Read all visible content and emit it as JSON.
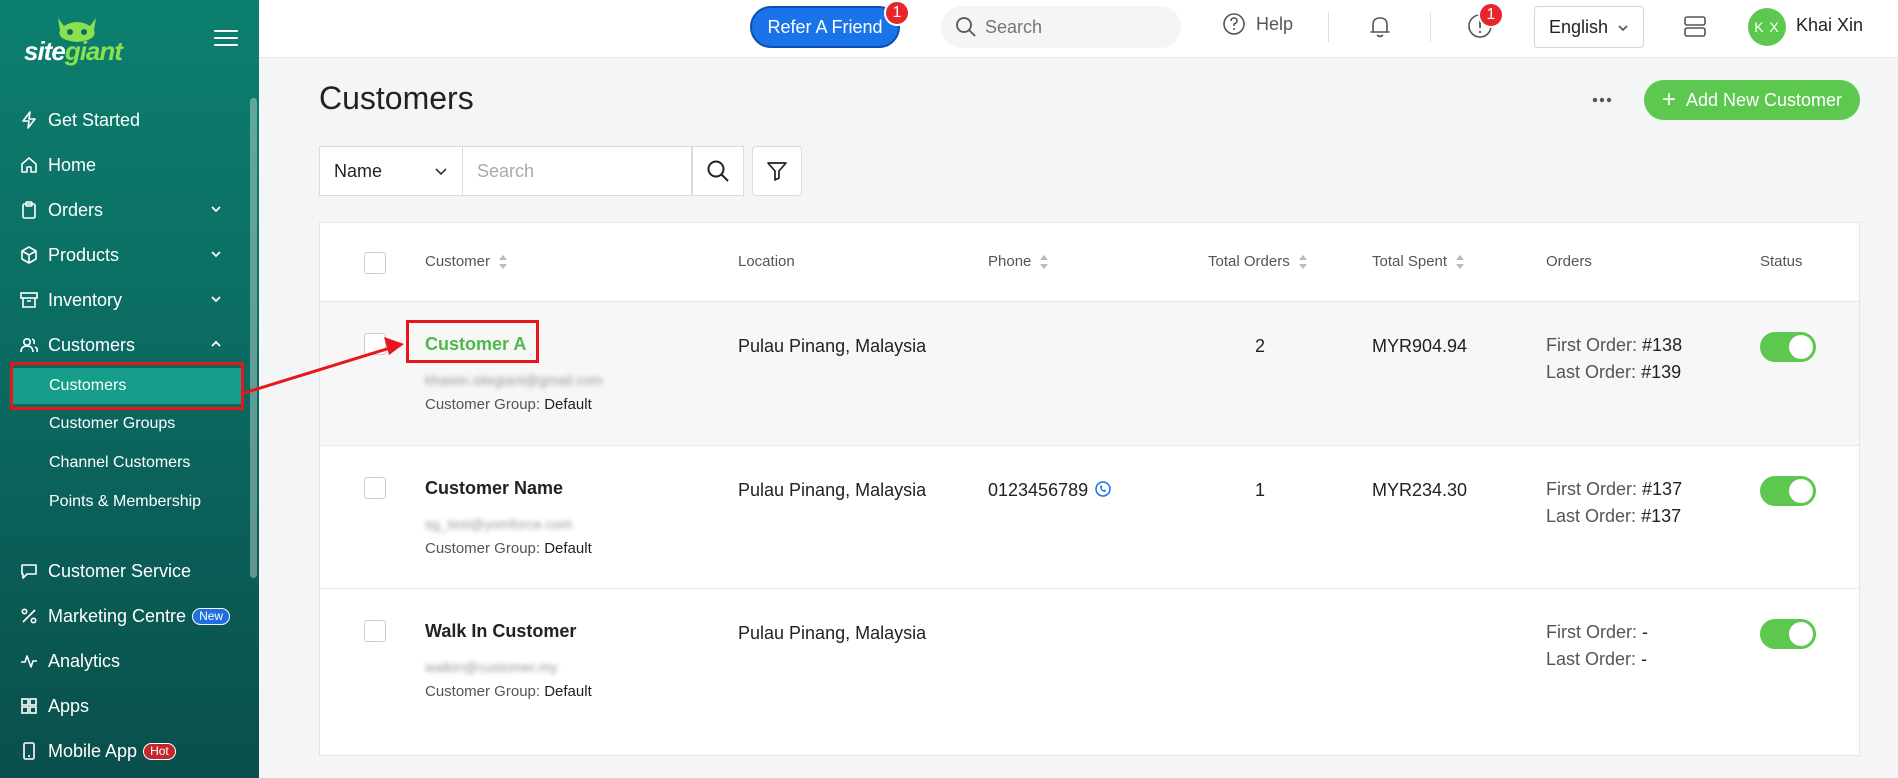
{
  "sidebar": {
    "brand": {
      "part1": "site",
      "part2": "giant"
    },
    "items": [
      {
        "label": "Get Started",
        "icon": "bolt-icon"
      },
      {
        "label": "Home",
        "icon": "home-icon"
      },
      {
        "label": "Orders",
        "icon": "clipboard-icon"
      },
      {
        "label": "Products",
        "icon": "box-icon"
      },
      {
        "label": "Inventory",
        "icon": "archive-icon"
      },
      {
        "label": "Customers",
        "icon": "users-icon"
      },
      {
        "label": "Customer Service",
        "icon": "chat-icon"
      },
      {
        "label": "Marketing Centre",
        "icon": "percent-icon",
        "badge": "New"
      },
      {
        "label": "Analytics",
        "icon": "pulse-icon"
      },
      {
        "label": "Apps",
        "icon": "grid-icon"
      },
      {
        "label": "Mobile App",
        "icon": "phone-icon",
        "badge": "Hot"
      }
    ],
    "customers_sub": [
      "Customers",
      "Customer Groups",
      "Channel Customers",
      "Points & Membership"
    ]
  },
  "topbar": {
    "refer_label": "Refer A Friend",
    "refer_badge": "1",
    "search_placeholder": "Search",
    "help_label": "Help",
    "alert_badge": "1",
    "language": "English",
    "avatar_initials": "K X",
    "user_name": "Khai Xin"
  },
  "main": {
    "title": "Customers",
    "add_button": "Add New Customer",
    "filter_field": "Name",
    "search_placeholder": "Search"
  },
  "table": {
    "columns": [
      "Customer",
      "Location",
      "Phone",
      "Total Orders",
      "Total Spent",
      "Orders",
      "Status"
    ],
    "group_label": "Customer Group:",
    "first_order_label": "First Order:",
    "last_order_label": "Last Order:",
    "rows": [
      {
        "name": "Customer A",
        "email": "khaixin.sitegiant@gmail.com",
        "group": "Default",
        "location": "Pulau Pinang, Malaysia",
        "phone": "",
        "total_orders": "2",
        "total_spent": "MYR904.94",
        "first_order": "#138",
        "last_order": "#139",
        "status": true
      },
      {
        "name": "Customer Name",
        "email": "sg_test@yomforce.com",
        "group": "Default",
        "location": "Pulau Pinang, Malaysia",
        "phone": "0123456789",
        "total_orders": "1",
        "total_spent": "MYR234.30",
        "first_order": "#137",
        "last_order": "#137",
        "status": true
      },
      {
        "name": "Walk In Customer",
        "email": "walkin@customer.my",
        "group": "Default",
        "location": "Pulau Pinang, Malaysia",
        "phone": "",
        "total_orders": "",
        "total_spent": "",
        "first_order": "-",
        "last_order": "-",
        "status": true
      }
    ]
  },
  "colors": {
    "accent_green": "#5dc84f",
    "sidebar": "#0b6b61",
    "primary_blue": "#1a73e8",
    "annotation_red": "#e8161b"
  }
}
